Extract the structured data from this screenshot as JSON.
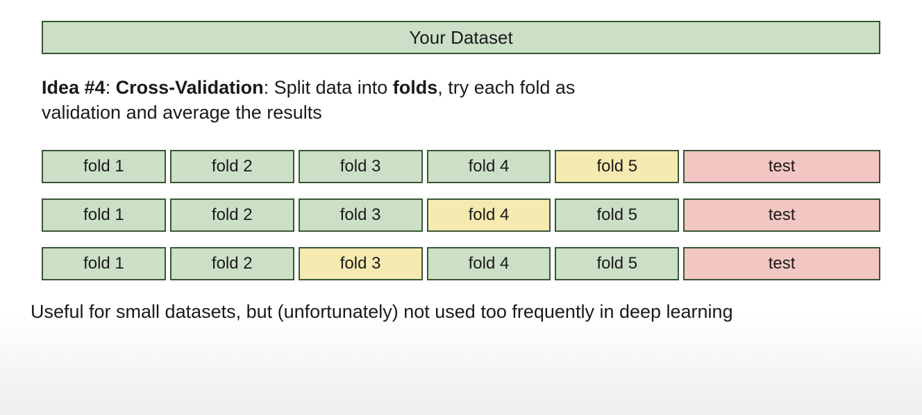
{
  "dataset_banner": "Your Dataset",
  "description": {
    "prefix": "Idea #4",
    "term": "Cross-Validation",
    "tail1": ": Split data into ",
    "bold2": "folds",
    "tail2": ", try each fold as validation and average the results"
  },
  "colors": {
    "green": "#cce0c7",
    "yellow": "#f7eab0",
    "red": "#f2c6c2"
  },
  "rows": [
    [
      {
        "label": "fold 1",
        "color": "green"
      },
      {
        "label": "fold 2",
        "color": "green"
      },
      {
        "label": "fold 3",
        "color": "green"
      },
      {
        "label": "fold 4",
        "color": "green"
      },
      {
        "label": "fold 5",
        "color": "yellow"
      },
      {
        "label": "test",
        "color": "red",
        "class": "test"
      }
    ],
    [
      {
        "label": "fold 1",
        "color": "green"
      },
      {
        "label": "fold 2",
        "color": "green"
      },
      {
        "label": "fold 3",
        "color": "green"
      },
      {
        "label": "fold 4",
        "color": "yellow"
      },
      {
        "label": "fold 5",
        "color": "green"
      },
      {
        "label": "test",
        "color": "red",
        "class": "test"
      }
    ],
    [
      {
        "label": "fold 1",
        "color": "green"
      },
      {
        "label": "fold 2",
        "color": "green"
      },
      {
        "label": "fold 3",
        "color": "yellow"
      },
      {
        "label": "fold 4",
        "color": "green"
      },
      {
        "label": "fold 5",
        "color": "green"
      },
      {
        "label": "test",
        "color": "red",
        "class": "test"
      }
    ]
  ],
  "footer": "Useful for small datasets, but (unfortunately) not used too frequently in deep learning"
}
